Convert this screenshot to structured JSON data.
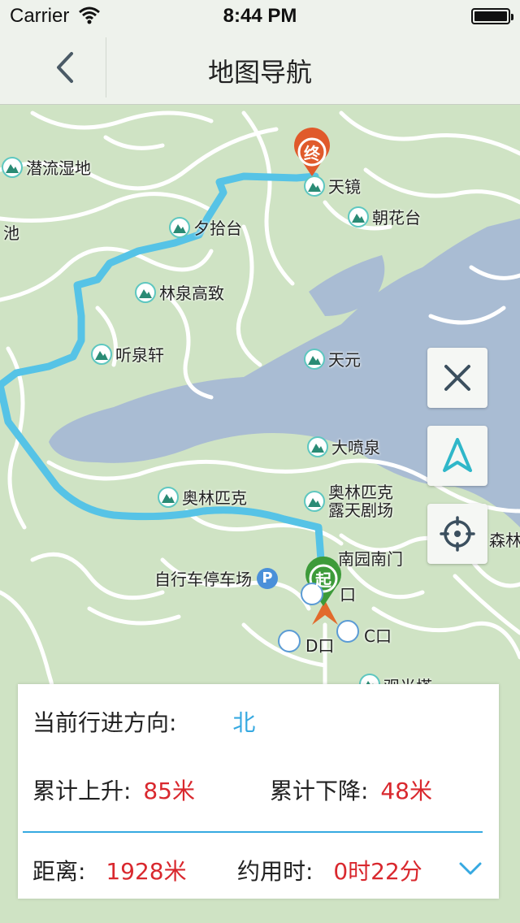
{
  "status_bar": {
    "carrier": "Carrier",
    "time": "8:44 PM"
  },
  "navbar": {
    "title": "地图导航",
    "back_icon": "chevron-left-icon"
  },
  "map": {
    "pois": [
      {
        "name": "潜流湿地"
      },
      {
        "name": "天镜"
      },
      {
        "name": "朝花台"
      },
      {
        "name": "夕拾台"
      },
      {
        "name": "池"
      },
      {
        "name": "林泉高致"
      },
      {
        "name": "听泉轩"
      },
      {
        "name": "天元"
      },
      {
        "name": "大喷泉"
      },
      {
        "name": "奥林匹克"
      },
      {
        "name": "奥林匹克露天剧场"
      },
      {
        "name": "南园南门"
      },
      {
        "name": "自行车停车场"
      },
      {
        "name": "C口"
      },
      {
        "name": "D口"
      },
      {
        "name": "口"
      },
      {
        "name": "森林"
      },
      {
        "name": "观光塔"
      }
    ],
    "start_marker": "起",
    "end_marker": "终",
    "parking_symbol": "P",
    "route_color": "#56c3e6",
    "buttons": [
      "close-icon",
      "navigate-arrow-icon",
      "locate-icon"
    ]
  },
  "info_panel": {
    "direction_label": "当前行进方向:",
    "direction_value": "北",
    "ascent_label": "累计上升:",
    "ascent_value": "85米",
    "descent_label": "累计下降:",
    "descent_value": "48米",
    "distance_label": "距离:",
    "distance_value": "1928米",
    "duration_label": "约用时:",
    "duration_value": "0时22分",
    "expand_icon": "chevron-down-icon"
  }
}
